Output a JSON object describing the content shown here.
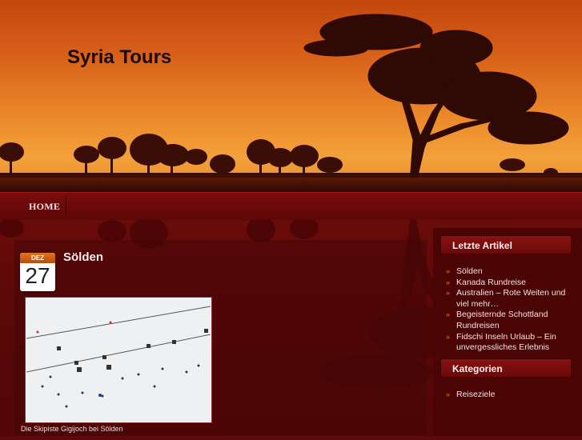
{
  "site": {
    "title": "Syria Tours"
  },
  "nav": {
    "items": [
      {
        "label": "HOME"
      }
    ]
  },
  "post": {
    "date_month": "DEZ",
    "date_day": "27",
    "title": "Sölden",
    "image_caption": "Die Skipiste Gigijoch bei Sölden"
  },
  "sidebar": {
    "recent": {
      "title": "Letzte Artikel",
      "items": [
        "Sölden",
        "Kanada Rundreise",
        "Australien – Rote Weiten und viel mehr…",
        "Begeisternde Schottland Rundreisen",
        "Fidschi Inseln Urlaub – Ein unvergessliches Erlebnis"
      ]
    },
    "categories": {
      "title": "Kategorien",
      "items": [
        "Reiseziele"
      ]
    }
  },
  "colors": {
    "accent": "#e1762a",
    "sky_top": "#c2460d",
    "sky_bottom": "#f3a13a",
    "body_bg": "#5a0a0a"
  }
}
